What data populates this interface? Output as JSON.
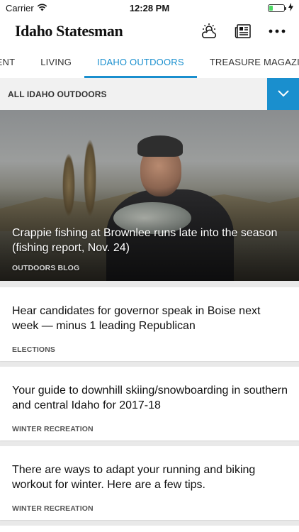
{
  "status_bar": {
    "carrier": "Carrier",
    "time": "12:28 PM",
    "battery_level": 0.25
  },
  "header": {
    "brand": "Idaho Statesman",
    "icons": [
      "weather-icon",
      "newspaper-icon",
      "more-icon"
    ]
  },
  "tabs": [
    {
      "label": "NMENT",
      "active": false
    },
    {
      "label": "LIVING",
      "active": false
    },
    {
      "label": "IDAHO OUTDOORS",
      "active": true
    },
    {
      "label": "TREASURE MAGAZINE",
      "active": false
    }
  ],
  "section": {
    "title": "ALL IDAHO OUTDOORS"
  },
  "hero": {
    "title": "Crappie fishing at Brownlee runs late into the season (fishing report, Nov. 24)",
    "category": "OUTDOORS BLOG"
  },
  "articles": [
    {
      "title": "Hear candidates for governor speak in Boise next week — minus 1 leading Republican",
      "category": "ELECTIONS"
    },
    {
      "title": "Your guide to downhill skiing/snowboarding in southern and central Idaho for 2017-18",
      "category": "WINTER RECREATION"
    },
    {
      "title": "There are ways to adapt your running and biking workout for winter. Here are a few tips.",
      "category": "WINTER RECREATION"
    }
  ],
  "colors": {
    "accent": "#1a8fce",
    "section_bg": "#f1f1f1",
    "feed_bg": "#e9e9e9"
  }
}
